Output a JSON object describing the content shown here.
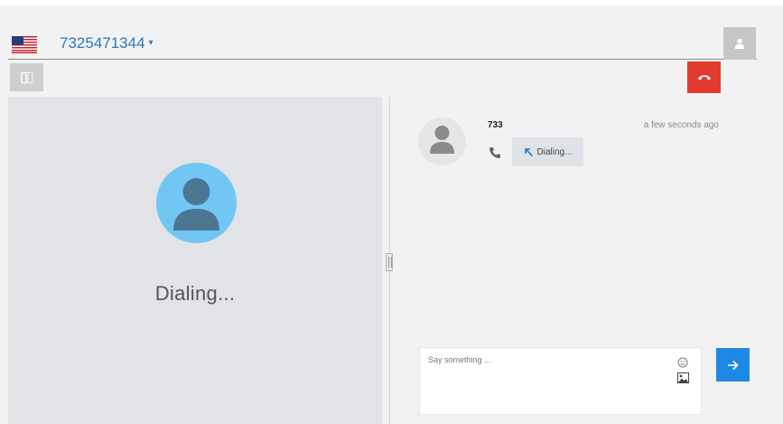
{
  "header": {
    "country_flag": "us-flag-icon",
    "phone_number": "7325471344",
    "dropdown_caret": "▾",
    "user_icon": "person-icon"
  },
  "toolbar": {
    "toggle_icon": "panel-toggle-icon",
    "hangup_icon": "phone-hangup-icon"
  },
  "call_panel": {
    "avatar_icon": "person-avatar-icon",
    "status": "Dialing..."
  },
  "chat": {
    "messages": [
      {
        "sender": "733",
        "time": "a few seconds ago",
        "type_icon": "phone-icon",
        "direction_icon": "outgoing-arrow-icon",
        "text": "Dialing..."
      }
    ]
  },
  "composer": {
    "placeholder": "Say something ...",
    "value": "",
    "emoji_icon": "smiley-icon",
    "image_icon": "image-icon",
    "send_icon": "arrow-right-icon"
  },
  "colors": {
    "accent": "#2b78b8",
    "send": "#1e88e5",
    "hangup": "#e23a2f",
    "avatar": "#72c6f4",
    "avatar_figure": "#4c7793",
    "panel": "#e1e3e6",
    "background": "#f2f2f2"
  }
}
